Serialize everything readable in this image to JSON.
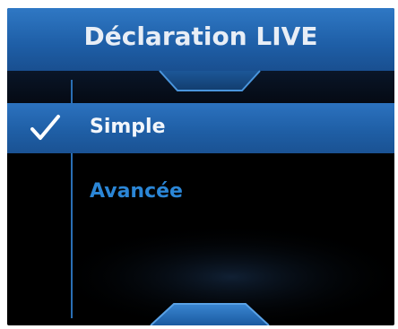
{
  "title": "Déclaration LIVE",
  "menu": {
    "items": [
      {
        "label": "Simple",
        "selected": true
      },
      {
        "label": "Avancée",
        "selected": false
      }
    ]
  },
  "icons": {
    "check": "checkmark-icon",
    "scroll_up": "scroll-up-arrow-icon",
    "scroll_down": "scroll-down-arrow-icon"
  },
  "colors": {
    "title_bar": "#1e5ea6",
    "selected_row": "#1f5fa6",
    "unselected_text": "#2b86d6",
    "background": "#000000"
  }
}
